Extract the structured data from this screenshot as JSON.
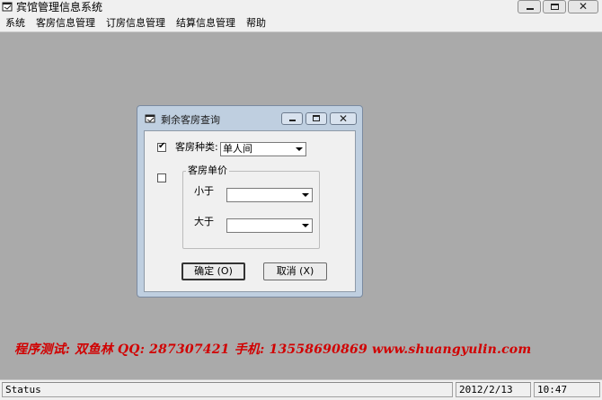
{
  "window": {
    "title": "宾馆管理信息系统",
    "close_glyph": "✕"
  },
  "menu": {
    "items": [
      "系统",
      "客房信息管理",
      "订房信息管理",
      "结算信息管理",
      "帮助"
    ]
  },
  "dialog": {
    "title": "剩余客房查询",
    "close_glyph": "✕",
    "room_type": {
      "checked": true,
      "check_glyph": "✔",
      "label": "客房种类:",
      "value": "单人间"
    },
    "price": {
      "checked": false,
      "group_label": "客房单价",
      "less_label": "小于",
      "less_value": "",
      "greater_label": "大于",
      "greater_value": ""
    },
    "ok_button": "确定 (O)",
    "cancel_button": "取消 (X)"
  },
  "watermark": "程序测试: 双鱼林   QQ: 287307421   手机: 13558690869   www.shuangyulin.com",
  "statusbar": {
    "status": "Status",
    "date": "2012/2/13",
    "time": "10:47"
  },
  "icons": {
    "app": "app-window-icon",
    "dialog": "dialog-window-icon"
  },
  "colors": {
    "mdi_background": "#aaaaaa",
    "dialog_frame": "#bfcfe0",
    "watermark": "#d10000"
  }
}
